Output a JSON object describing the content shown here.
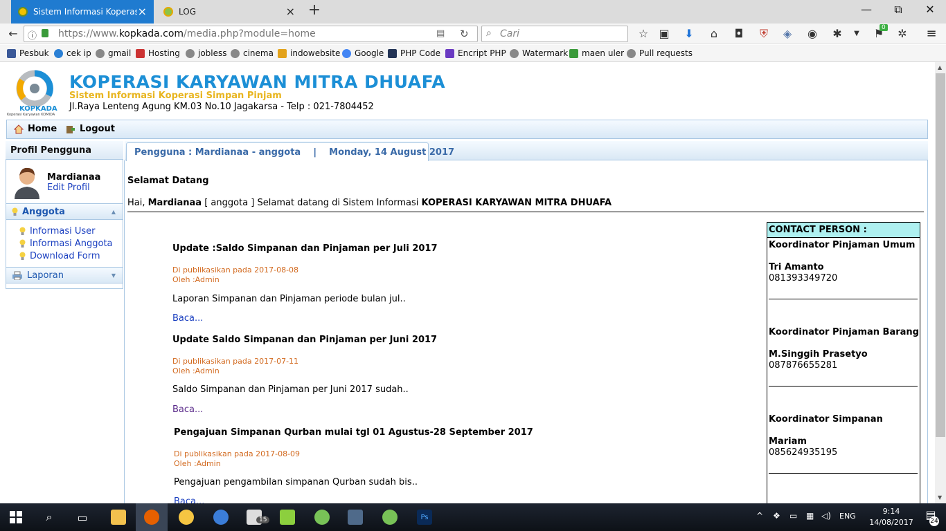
{
  "browser": {
    "tabs": [
      {
        "title": "Sistem Informasi Koperasi Si",
        "active": true
      },
      {
        "title": "LOG",
        "active": false
      }
    ],
    "new_tab": "+",
    "window_controls": [
      "—",
      "⧉",
      "✕"
    ],
    "url_prefix": "https://www.",
    "url_host": "kopkada.com",
    "url_path": "/media.php?module=home",
    "search_placeholder": "Cari",
    "bookmarks": [
      {
        "label": "Pesbuk",
        "color": "#3b5998"
      },
      {
        "label": "cek ip",
        "color": "#2a7fd4"
      },
      {
        "label": "gmail",
        "color": "#777777"
      },
      {
        "label": "Hosting",
        "color": "#cc3333"
      },
      {
        "label": "jobless",
        "color": "#777777"
      },
      {
        "label": "cinema",
        "color": "#777777"
      },
      {
        "label": "indowebsite",
        "color": "#e3a21a"
      },
      {
        "label": "Google",
        "color": "#4285f4"
      },
      {
        "label": "PHP Code",
        "color": "#223355"
      },
      {
        "label": "Encript PHP",
        "color": "#6a3ac2"
      },
      {
        "label": "Watermark",
        "color": "#777777"
      },
      {
        "label": "maen uler",
        "color": "#3a9a3a"
      },
      {
        "label": "Pull requests",
        "color": "#777777"
      }
    ]
  },
  "site": {
    "logo_text": "KOPKADA",
    "logo_sub": "Koperasi Karyawan KOMIDA",
    "title": "KOPERASI KARYAWAN MITRA DHUAFA",
    "subtitle": "Sistem Informasi Koperasi Simpan Pinjam",
    "address": "Jl.Raya Lenteng Agung KM.03 No.10 Jagakarsa - Telp : 021-7804452",
    "colors": {
      "title": "#1c8fd6",
      "subtitle": "#e8b51f",
      "link": "#1a3fc0",
      "meta": "#d2691e",
      "contact_head": "#aef0f0"
    }
  },
  "menu": {
    "home": "Home",
    "logout": "Logout"
  },
  "sidebar": {
    "profile_header": "Profil Pengguna",
    "user_name": "Mardianaa",
    "edit_profile": "Edit Profil",
    "sections": [
      {
        "label": "Anggota",
        "expanded": true,
        "items": [
          "Informasi User",
          "Informasi Anggota",
          "Download Form"
        ]
      },
      {
        "label": "Laporan",
        "expanded": false,
        "items": []
      }
    ]
  },
  "content": {
    "tab_user": "Pengguna : Mardianaa - anggota",
    "tab_sep": "|",
    "tab_date": "Monday, 14 August 2017",
    "welcome_heading": "Selamat Datang",
    "welcome_pre": "Hai, ",
    "welcome_name": "Mardianaa",
    "welcome_mid": " [ anggota ] Selamat datang di Sistem Informasi ",
    "welcome_org": "KOPERASI KARYAWAN MITRA DHUAFA",
    "news": [
      {
        "title": "Update :Saldo Simpanan dan Pinjaman per Juli 2017",
        "date_line": "Di publikasikan pada 2017-08-08",
        "author_line": "Oleh :Admin",
        "summary": "Laporan Simpanan dan Pinjaman periode bulan jul..",
        "more": "Baca...",
        "visited": false
      },
      {
        "title": "Update Saldo Simpanan dan Pinjaman per Juni 2017",
        "date_line": "Di publikasikan pada 2017-07-11",
        "author_line": "Oleh :Admin",
        "summary": "Saldo Simpanan dan Pinjaman per Juni 2017 sudah..",
        "more": "Baca...",
        "visited": true
      },
      {
        "title": "Pengajuan Simpanan Qurban mulai tgl 01 Agustus-28 September 2017",
        "date_line": "Di publikasikan pada 2017-08-09",
        "author_line": "Oleh :Admin",
        "summary": "Pengajuan pengambilan simpanan Qurban sudah bis..",
        "more": "Baca...",
        "visited": false
      }
    ],
    "contact": {
      "header": "CONTACT PERSON :",
      "people": [
        {
          "role": "Koordinator Pinjaman Umum",
          "name": "Tri Amanto",
          "phone": "081393349720"
        },
        {
          "role": "Koordinator Pinjaman Barang",
          "name": "M.Singgih Prasetyo",
          "phone": "087876655281"
        },
        {
          "role": "Koordinator Simpanan",
          "name": "Mariam",
          "phone": "085624935195"
        }
      ]
    }
  },
  "taskbar": {
    "mail_badge": "15",
    "lang": "ENG",
    "time": "9:14",
    "date": "14/08/2017",
    "notif_count": "24",
    "addon_badge": "0"
  }
}
